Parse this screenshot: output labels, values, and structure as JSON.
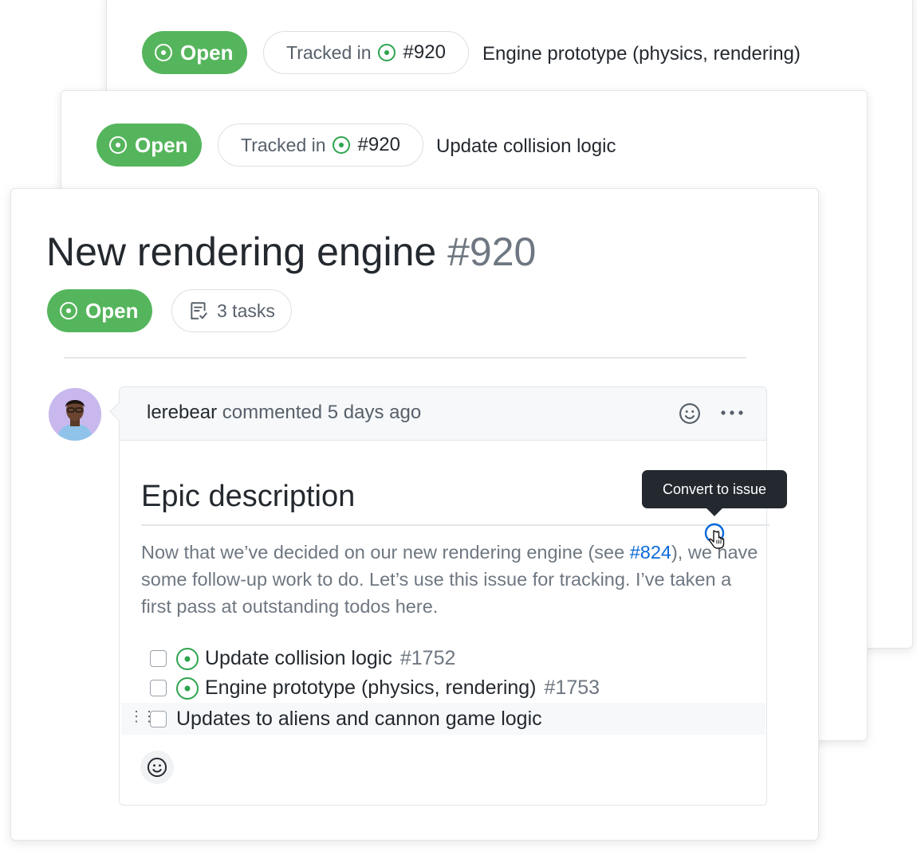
{
  "back_card_1": {
    "status": "Open",
    "tracked_label": "Tracked in",
    "tracked_number": "#920",
    "title": "Engine prototype (physics, rendering)"
  },
  "back_card_2": {
    "status": "Open",
    "tracked_label": "Tracked in",
    "tracked_number": "#920",
    "title": "Update collision logic"
  },
  "issue": {
    "title": "New rendering engine",
    "number": "#920",
    "status": "Open",
    "tasks_label": "3 tasks"
  },
  "comment": {
    "author": "lerebear",
    "action": "commented 5 days ago",
    "heading": "Epic description",
    "body_before": "Now that we’ve decided on our new rendering engine (see ",
    "body_link": "#824",
    "body_after": "), we have some follow-up work to do. Let’s use this issue for tracking. I’ve taken a first pass at outstanding todos here.",
    "tasks": [
      {
        "title": "Update collision logic",
        "number": "#1752",
        "tracked": true
      },
      {
        "title": "Engine prototype (physics, rendering)",
        "number": "#1753",
        "tracked": true
      },
      {
        "title": "Updates to aliens and cannon game logic",
        "number": "",
        "tracked": false
      }
    ]
  },
  "tooltip": {
    "text": "Convert to issue"
  },
  "colors": {
    "open_green": "#55b55c",
    "link_blue": "#0969da",
    "tooltip_bg": "#24292f"
  },
  "icons": [
    "issue-opened-icon",
    "tasklist-icon",
    "smiley-icon",
    "kebab-horizontal-icon",
    "grabber-icon",
    "pointer-hand-icon"
  ]
}
